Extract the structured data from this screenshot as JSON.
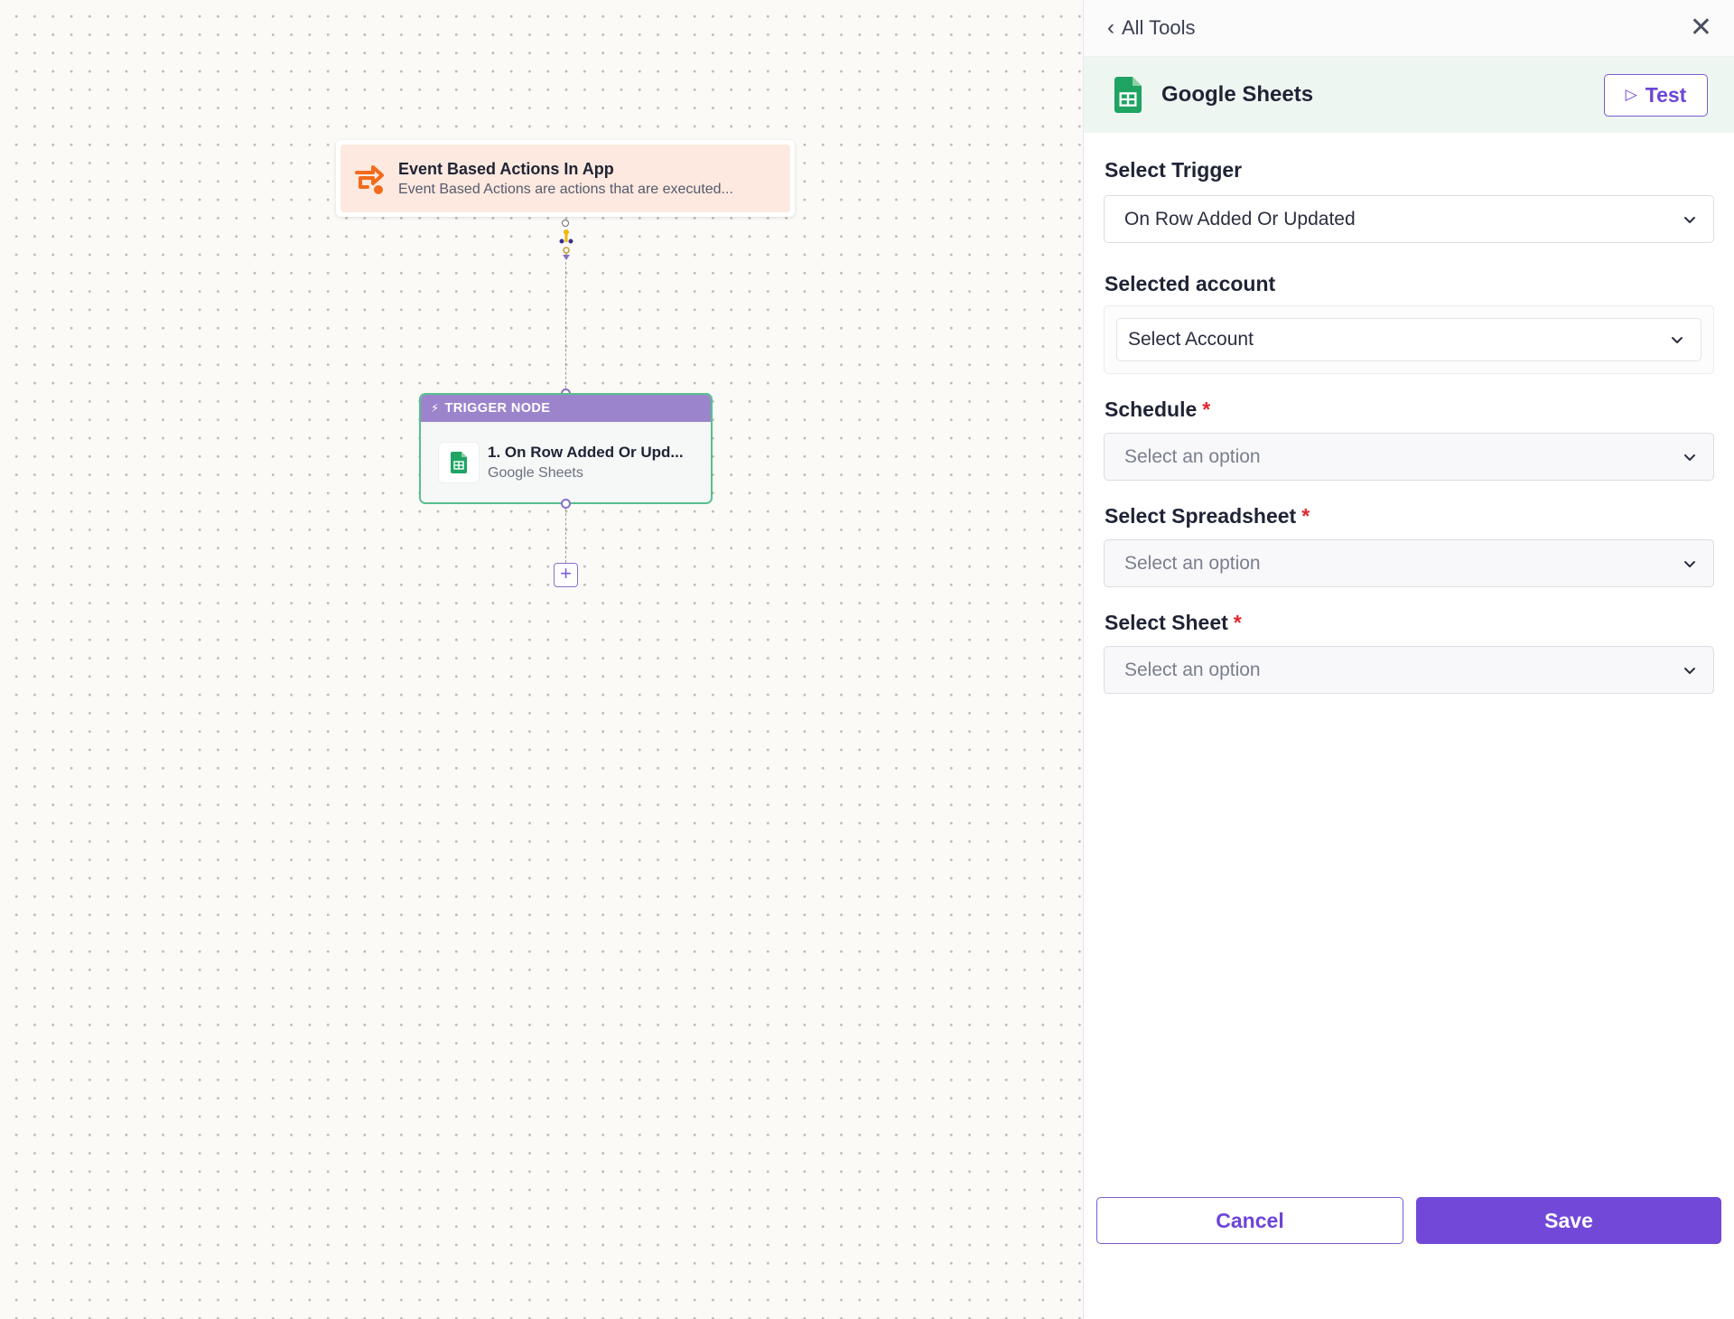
{
  "canvas": {
    "event_node": {
      "title": "Event Based Actions In App",
      "description": "Event Based Actions are actions that are executed..."
    },
    "trigger_node": {
      "header": "TRIGGER NODE",
      "title": "1. On Row Added Or Upd...",
      "subtitle": "Google Sheets"
    },
    "add_step": "+"
  },
  "panel": {
    "back_label": "All Tools",
    "close_symbol": "✕",
    "tool_name": "Google Sheets",
    "test_label": "Test",
    "fields": {
      "trigger": {
        "label": "Select Trigger",
        "value": "On Row Added Or Updated"
      },
      "account": {
        "label": "Selected account",
        "value": "Select Account"
      },
      "schedule": {
        "label": "Schedule",
        "required": "*",
        "placeholder": "Select an option"
      },
      "spreadsheet": {
        "label": "Select Spreadsheet",
        "required": "*",
        "placeholder": "Select an option"
      },
      "sheet": {
        "label": "Select Sheet",
        "required": "*",
        "placeholder": "Select an option"
      }
    },
    "cancel_label": "Cancel",
    "save_label": "Save"
  },
  "colors": {
    "accent": "#7248d9",
    "trigger_header": "#9b84cc",
    "node_border": "#56c08e",
    "sheets_green": "#1fa463",
    "event_bg": "#fde9df",
    "event_icon": "#f26b1d"
  },
  "icons": [
    "event-actions-icon",
    "google-sheets-icon",
    "lightning-icon",
    "chevron-left-icon",
    "close-icon",
    "play-icon",
    "chevron-down-icon",
    "plus-icon"
  ]
}
